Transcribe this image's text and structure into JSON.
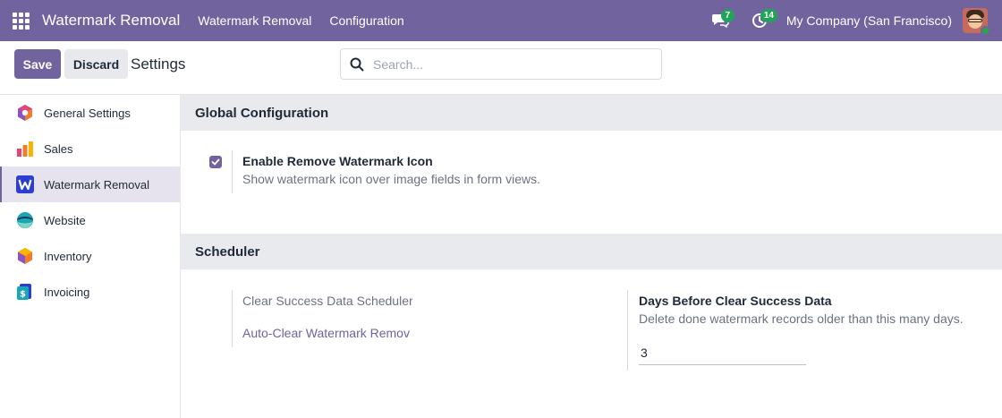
{
  "navbar": {
    "brand": "Watermark Removal",
    "menu": [
      "Watermark Removal",
      "Configuration"
    ],
    "messages_count": "7",
    "activities_count": "14",
    "company": "My Company (San Francisco)",
    "color": "#71639e"
  },
  "control": {
    "save_label": "Save",
    "discard_label": "Discard",
    "breadcrumb": "Settings",
    "search_placeholder": "Search..."
  },
  "sidebar": {
    "items": [
      {
        "label": "General Settings",
        "icon": "general-settings-icon"
      },
      {
        "label": "Sales",
        "icon": "sales-icon"
      },
      {
        "label": "Watermark Removal",
        "icon": "watermark-app-icon",
        "active": true
      },
      {
        "label": "Website",
        "icon": "website-icon"
      },
      {
        "label": "Inventory",
        "icon": "inventory-icon"
      },
      {
        "label": "Invoicing",
        "icon": "invoicing-icon"
      }
    ]
  },
  "sections": {
    "global": {
      "title": "Global Configuration",
      "setting_label": "Enable Remove Watermark Icon",
      "setting_help": "Show watermark icon over image fields in form views.",
      "checked": true
    },
    "scheduler": {
      "title": "Scheduler",
      "clear_label": "Clear Success Data Scheduler",
      "clear_link": "Auto-Clear Watermark Remov",
      "days_label": "Days Before Clear Success Data",
      "days_help": "Delete done watermark records older than this many days.",
      "days_value": "3"
    }
  }
}
